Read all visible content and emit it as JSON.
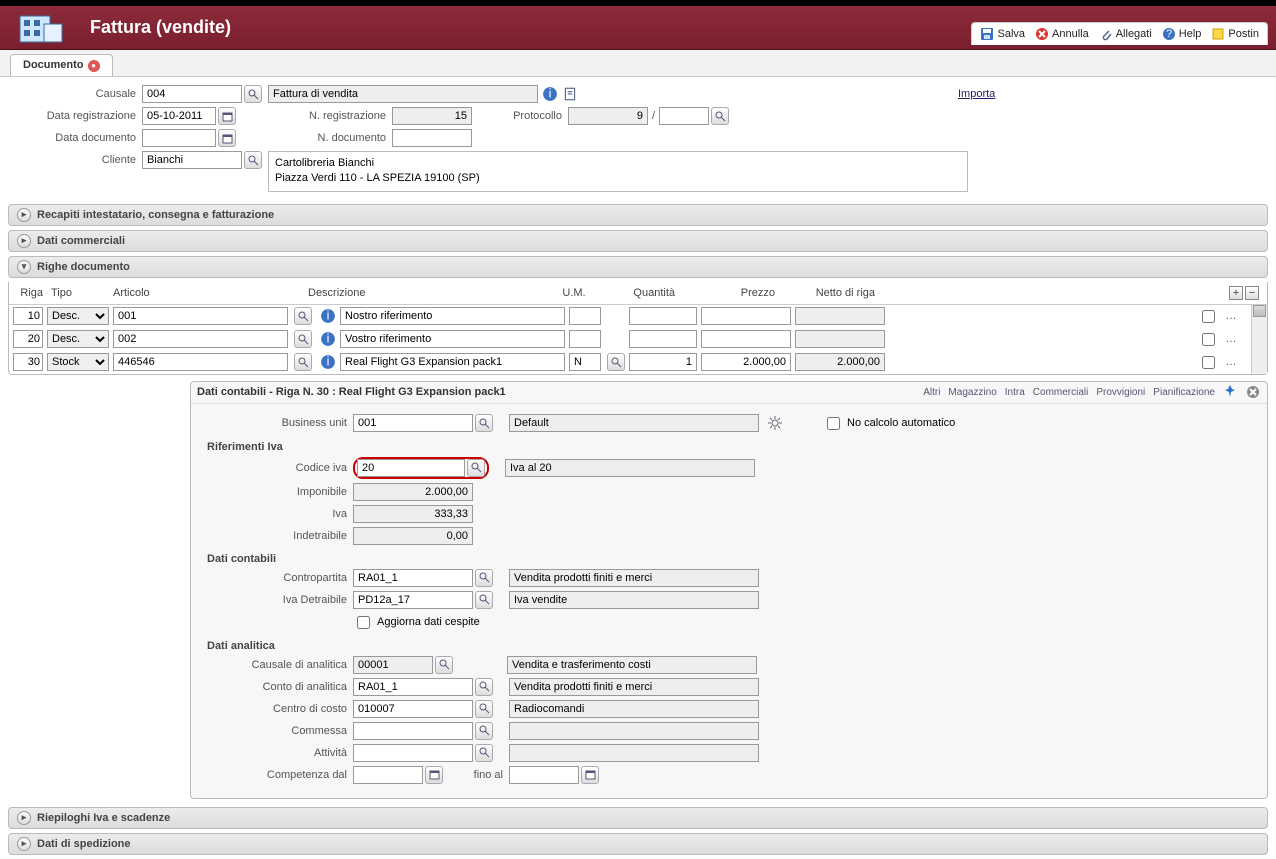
{
  "header": {
    "title": "Fattura (vendite)"
  },
  "toolbar": {
    "save": "Salva",
    "cancel": "Annulla",
    "attach": "Allegati",
    "help": "Help",
    "postin": "Postin"
  },
  "tab": {
    "label": "Documento"
  },
  "form": {
    "causale_lbl": "Causale",
    "causale": "004",
    "causale_desc": "Fattura di vendita",
    "data_reg_lbl": "Data registrazione",
    "data_reg": "05-10-2011",
    "n_reg_lbl": "N. registrazione",
    "n_reg": "15",
    "protocollo_lbl": "Protocollo",
    "protocollo": "9",
    "protocollo_sep": "/",
    "data_doc_lbl": "Data documento",
    "data_doc": "",
    "n_doc_lbl": "N. documento",
    "n_doc": "",
    "cliente_lbl": "Cliente",
    "cliente": "Bianchi",
    "cliente_desc_line1": "Cartolibreria Bianchi",
    "cliente_desc_line2": "Piazza Verdi 110 - LA SPEZIA 19100 (SP)",
    "importa": "Importa"
  },
  "panels": {
    "recapiti": "Recapiti intestatario, consegna e fatturazione",
    "dati_comm": "Dati commerciali",
    "righe": "Righe documento",
    "riepiloghi": "Riepiloghi Iva e scadenze",
    "spedizione": "Dati di spedizione"
  },
  "grid": {
    "hdr": {
      "riga": "Riga",
      "tipo": "Tipo",
      "articolo": "Articolo",
      "desc": "Descrizione",
      "um": "U.M.",
      "qt": "Quantità",
      "pz": "Prezzo",
      "net": "Netto di riga"
    },
    "rows": [
      {
        "riga": "10",
        "tipo": "Desc.",
        "art": "001",
        "desc": "Nostro riferimento",
        "um": "",
        "qt": "",
        "pz": "",
        "net": ""
      },
      {
        "riga": "20",
        "tipo": "Desc.",
        "art": "002",
        "desc": "Vostro riferimento",
        "um": "",
        "qt": "",
        "pz": "",
        "net": ""
      },
      {
        "riga": "30",
        "tipo": "Stock",
        "art": "446546",
        "desc": "Real Flight G3 Expansion pack1",
        "um": "N",
        "qt": "1",
        "pz": "2.000,00",
        "net": "2.000,00"
      }
    ]
  },
  "detail": {
    "title": "Dati contabili - Riga N. 30 : Real Flight G3 Expansion pack1",
    "links": {
      "altri": "Altri",
      "magazzino": "Magazzino",
      "intra": "Intra",
      "commerciali": "Commerciali",
      "provvigioni": "Provvigioni",
      "pianif": "Pianificazione"
    },
    "bu_lbl": "Business unit",
    "bu": "001",
    "bu_desc": "Default",
    "nocalc": "No calcolo automatico",
    "rif_iva_title": "Riferimenti Iva",
    "codiva_lbl": "Codice iva",
    "codiva": "20",
    "codiva_desc": "Iva al 20",
    "imponibile_lbl": "Imponibile",
    "imponibile": "2.000,00",
    "iva_lbl": "Iva",
    "iva": "333,33",
    "indetr_lbl": "Indetraibile",
    "indetr": "0,00",
    "dati_cont_title": "Dati contabili",
    "contro_lbl": "Contropartita",
    "contro": "RA01_1",
    "contro_desc": "Vendita prodotti finiti e merci",
    "ivadet_lbl": "Iva Detraibile",
    "ivadet": "PD12a_17",
    "ivadet_desc": "Iva vendite",
    "agg_cespite": "Aggiorna dati cespite",
    "dati_anal_title": "Dati analitica",
    "causanal_lbl": "Causale di analitica",
    "causanal": "00001",
    "causanal_desc": "Vendita e trasferimento costi",
    "contoanal_lbl": "Conto di analitica",
    "contoanal": "RA01_1",
    "contoanal_desc": "Vendita prodotti finiti e merci",
    "centro_lbl": "Centro di costo",
    "centro": "010007",
    "centro_desc": "Radiocomandi",
    "commessa_lbl": "Commessa",
    "commessa": "",
    "commessa_desc": "",
    "attivita_lbl": "Attività",
    "attivita": "",
    "attivita_desc": "",
    "comp_dal_lbl": "Competenza dal",
    "comp_dal": "",
    "fino_al_lbl": "fino al",
    "fino_al": ""
  }
}
